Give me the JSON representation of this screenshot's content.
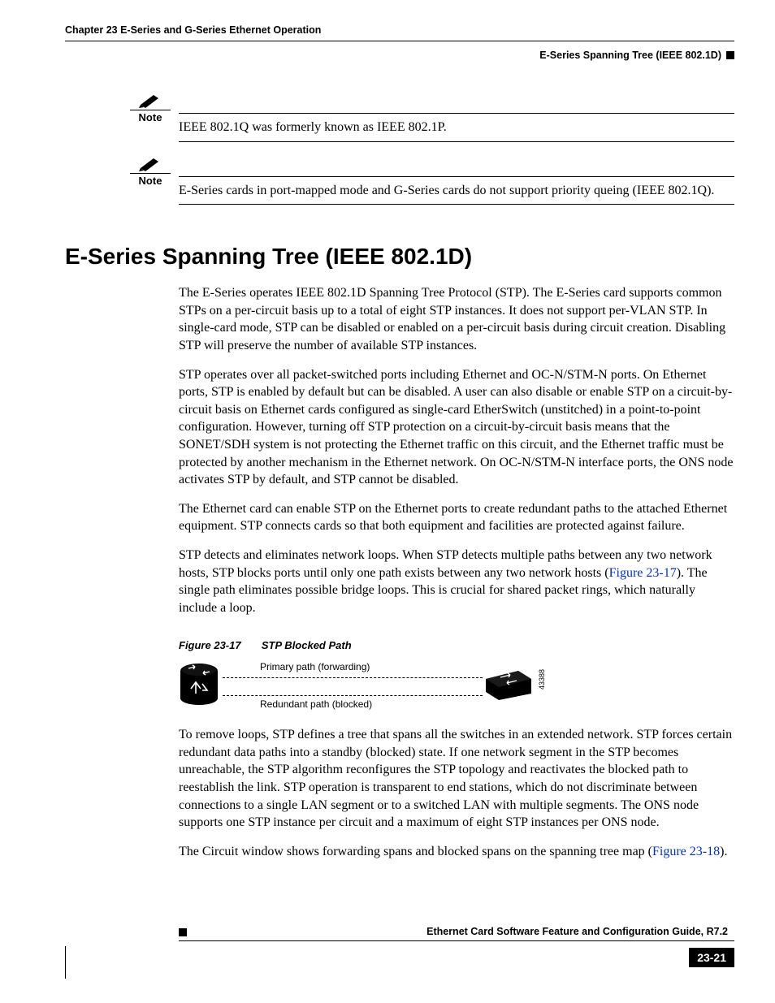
{
  "header": {
    "chapter": "Chapter 23 E-Series and G-Series Ethernet Operation",
    "section": "E-Series Spanning Tree (IEEE 802.1D)"
  },
  "notes": [
    {
      "label": "Note",
      "text": "IEEE 802.1Q was formerly known as IEEE 802.1P."
    },
    {
      "label": "Note",
      "text": "E-Series cards in port-mapped mode and G-Series cards do not support priority queing (IEEE 802.1Q)."
    }
  ],
  "title": "E-Series Spanning Tree (IEEE 802.1D)",
  "paragraphs": {
    "p1": "The E-Series operates IEEE 802.1D Spanning Tree Protocol (STP). The E-Series card supports common STPs on a per-circuit basis up to a total of eight STP instances. It does not support per-VLAN STP. In single-card mode, STP can be disabled or enabled on a per-circuit basis during circuit creation. Disabling STP will preserve the number of available STP instances.",
    "p2": "STP operates over all packet-switched ports including Ethernet and OC-N/STM-N ports. On Ethernet ports, STP is enabled by default but can be disabled. A user can also disable or enable STP on a circuit-by-circuit basis on Ethernet cards configured as single-card EtherSwitch (unstitched) in a point-to-point configuration. However, turning off STP protection on a circuit-by-circuit basis means that the SONET/SDH system is not protecting the Ethernet traffic on this circuit, and the Ethernet traffic must be protected by another mechanism in the Ethernet network. On OC-N/STM-N interface ports, the ONS node activates STP by default, and STP cannot be disabled.",
    "p3": "The Ethernet card can enable STP on the Ethernet ports to create redundant paths to the attached Ethernet equipment. STP connects cards so that both equipment and facilities are protected against failure.",
    "p4a": "STP detects and eliminates network loops. When STP detects multiple paths between any two network hosts, STP blocks ports until only one path exists between any two network hosts (",
    "p4link": "Figure 23-17",
    "p4b": "). The single path eliminates possible bridge loops. This is crucial for shared packet rings, which naturally include a loop.",
    "p5": "To remove loops, STP defines a tree that spans all the switches in an extended network. STP forces certain redundant data paths into a standby (blocked) state. If one network segment in the STP becomes unreachable, the STP algorithm reconfigures the STP topology and reactivates the blocked path to reestablish the link. STP operation is transparent to end stations, which do not discriminate between connections to a single LAN segment or to a switched LAN with multiple segments. The ONS node supports one STP instance per circuit and a maximum of eight STP instances per ONS node.",
    "p6a": "The Circuit window shows forwarding spans and blocked spans on the spanning tree map (",
    "p6link": "Figure 23-18",
    "p6b": ")."
  },
  "figure": {
    "label": "Figure 23-17",
    "title": "STP Blocked Path",
    "primary": "Primary path (forwarding)",
    "redundant": "Redundant path (blocked)",
    "id": "43388"
  },
  "footer": {
    "guide": "Ethernet Card Software Feature and Configuration Guide, R7.2",
    "page": "23-21"
  }
}
